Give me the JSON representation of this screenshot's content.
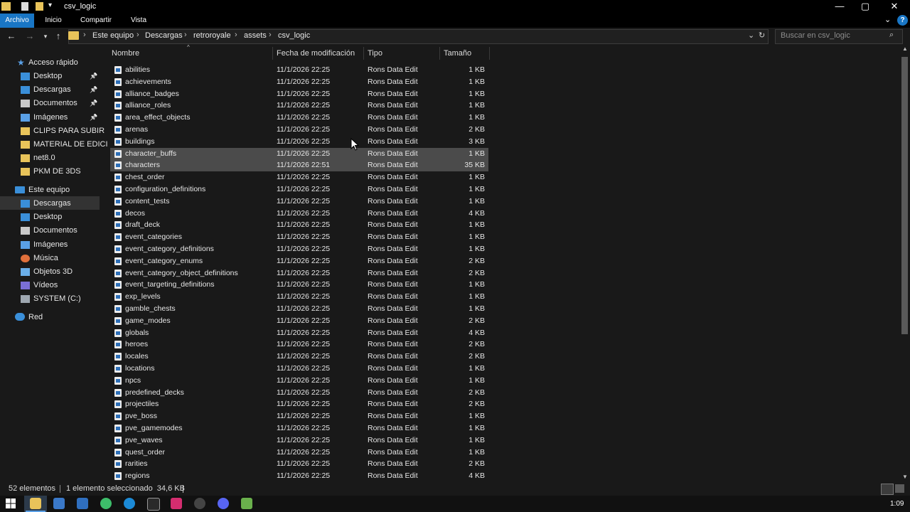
{
  "window": {
    "title": "csv_logic",
    "controls": [
      "—",
      "▢",
      "✕"
    ]
  },
  "ribbon": {
    "tabs": [
      "Archivo",
      "Inicio",
      "Compartir",
      "Vista"
    ],
    "help": "?"
  },
  "address": {
    "crumbs": [
      "Este equipo",
      "Descargas",
      "retroroyale",
      "assets",
      "csv_logic"
    ],
    "search_placeholder": "Buscar en csv_logic"
  },
  "sidebar": {
    "quick_access": "Acceso rápido",
    "quick_items": [
      {
        "label": "Desktop",
        "icon": "desktop-icon",
        "pinned": true
      },
      {
        "label": "Descargas",
        "icon": "download-icon",
        "pinned": true
      },
      {
        "label": "Documentos",
        "icon": "document-icon",
        "pinned": true
      },
      {
        "label": "Imágenes",
        "icon": "image-icon",
        "pinned": true
      },
      {
        "label": "CLIPS PARA SUBIR",
        "icon": "folder-icon",
        "pinned": false
      },
      {
        "label": "MATERIAL DE EDICI",
        "icon": "folder-icon",
        "pinned": false
      },
      {
        "label": "net8.0",
        "icon": "folder-icon",
        "pinned": false
      },
      {
        "label": "PKM DE 3DS",
        "icon": "folder-icon",
        "pinned": false
      }
    ],
    "this_pc": "Este equipo",
    "pc_items": [
      {
        "label": "Descargas",
        "icon": "download-icon"
      },
      {
        "label": "Desktop",
        "icon": "desktop-icon"
      },
      {
        "label": "Documentos",
        "icon": "document-icon"
      },
      {
        "label": "Imágenes",
        "icon": "image-icon"
      },
      {
        "label": "Música",
        "icon": "music-icon"
      },
      {
        "label": "Objetos 3D",
        "icon": "cube-icon"
      },
      {
        "label": "Vídeos",
        "icon": "video-icon"
      },
      {
        "label": "SYSTEM (C:)",
        "icon": "drive-icon"
      }
    ],
    "network": "Red"
  },
  "columns": [
    "Nombre",
    "Fecha de modificación",
    "Tipo",
    "Tamaño"
  ],
  "files": [
    {
      "name": "abilities",
      "date": "11/1/2026 22:25",
      "type": "Rons Data Edit",
      "size": "1 KB"
    },
    {
      "name": "achievements",
      "date": "11/1/2026 22:25",
      "type": "Rons Data Edit",
      "size": "1 KB"
    },
    {
      "name": "alliance_badges",
      "date": "11/1/2026 22:25",
      "type": "Rons Data Edit",
      "size": "1 KB"
    },
    {
      "name": "alliance_roles",
      "date": "11/1/2026 22:25",
      "type": "Rons Data Edit",
      "size": "1 KB"
    },
    {
      "name": "area_effect_objects",
      "date": "11/1/2026 22:25",
      "type": "Rons Data Edit",
      "size": "1 KB"
    },
    {
      "name": "arenas",
      "date": "11/1/2026 22:25",
      "type": "Rons Data Edit",
      "size": "2 KB"
    },
    {
      "name": "buildings",
      "date": "11/1/2026 22:25",
      "type": "Rons Data Edit",
      "size": "3 KB"
    },
    {
      "name": "character_buffs",
      "date": "11/1/2026 22:25",
      "type": "Rons Data Edit",
      "size": "1 KB"
    },
    {
      "name": "characters",
      "date": "11/1/2026 22:51",
      "type": "Rons Data Edit",
      "size": "35 KB"
    },
    {
      "name": "chest_order",
      "date": "11/1/2026 22:25",
      "type": "Rons Data Edit",
      "size": "1 KB"
    },
    {
      "name": "configuration_definitions",
      "date": "11/1/2026 22:25",
      "type": "Rons Data Edit",
      "size": "1 KB"
    },
    {
      "name": "content_tests",
      "date": "11/1/2026 22:25",
      "type": "Rons Data Edit",
      "size": "1 KB"
    },
    {
      "name": "decos",
      "date": "11/1/2026 22:25",
      "type": "Rons Data Edit",
      "size": "4 KB"
    },
    {
      "name": "draft_deck",
      "date": "11/1/2026 22:25",
      "type": "Rons Data Edit",
      "size": "1 KB"
    },
    {
      "name": "event_categories",
      "date": "11/1/2026 22:25",
      "type": "Rons Data Edit",
      "size": "1 KB"
    },
    {
      "name": "event_category_definitions",
      "date": "11/1/2026 22:25",
      "type": "Rons Data Edit",
      "size": "1 KB"
    },
    {
      "name": "event_category_enums",
      "date": "11/1/2026 22:25",
      "type": "Rons Data Edit",
      "size": "2 KB"
    },
    {
      "name": "event_category_object_definitions",
      "date": "11/1/2026 22:25",
      "type": "Rons Data Edit",
      "size": "2 KB"
    },
    {
      "name": "event_targeting_definitions",
      "date": "11/1/2026 22:25",
      "type": "Rons Data Edit",
      "size": "1 KB"
    },
    {
      "name": "exp_levels",
      "date": "11/1/2026 22:25",
      "type": "Rons Data Edit",
      "size": "1 KB"
    },
    {
      "name": "gamble_chests",
      "date": "11/1/2026 22:25",
      "type": "Rons Data Edit",
      "size": "1 KB"
    },
    {
      "name": "game_modes",
      "date": "11/1/2026 22:25",
      "type": "Rons Data Edit",
      "size": "2 KB"
    },
    {
      "name": "globals",
      "date": "11/1/2026 22:25",
      "type": "Rons Data Edit",
      "size": "4 KB"
    },
    {
      "name": "heroes",
      "date": "11/1/2026 22:25",
      "type": "Rons Data Edit",
      "size": "2 KB"
    },
    {
      "name": "locales",
      "date": "11/1/2026 22:25",
      "type": "Rons Data Edit",
      "size": "2 KB"
    },
    {
      "name": "locations",
      "date": "11/1/2026 22:25",
      "type": "Rons Data Edit",
      "size": "1 KB"
    },
    {
      "name": "npcs",
      "date": "11/1/2026 22:25",
      "type": "Rons Data Edit",
      "size": "1 KB"
    },
    {
      "name": "predefined_decks",
      "date": "11/1/2026 22:25",
      "type": "Rons Data Edit",
      "size": "2 KB"
    },
    {
      "name": "projectiles",
      "date": "11/1/2026 22:25",
      "type": "Rons Data Edit",
      "size": "2 KB"
    },
    {
      "name": "pve_boss",
      "date": "11/1/2026 22:25",
      "type": "Rons Data Edit",
      "size": "1 KB"
    },
    {
      "name": "pve_gamemodes",
      "date": "11/1/2026 22:25",
      "type": "Rons Data Edit",
      "size": "1 KB"
    },
    {
      "name": "pve_waves",
      "date": "11/1/2026 22:25",
      "type": "Rons Data Edit",
      "size": "1 KB"
    },
    {
      "name": "quest_order",
      "date": "11/1/2026 22:25",
      "type": "Rons Data Edit",
      "size": "1 KB"
    },
    {
      "name": "rarities",
      "date": "11/1/2026 22:25",
      "type": "Rons Data Edit",
      "size": "2 KB"
    },
    {
      "name": "regions",
      "date": "11/1/2026 22:25",
      "type": "Rons Data Edit",
      "size": "4 KB"
    }
  ],
  "selected_files": [
    "character_buffs",
    "characters"
  ],
  "status": {
    "count": "52 elementos",
    "selection": "1 elemento seleccionado  34,6 KB"
  },
  "taskbar": {
    "clock": "1:09"
  },
  "colors": {
    "accent": "#1976c5",
    "selection": "#4b4b4b",
    "background": "#191919"
  }
}
